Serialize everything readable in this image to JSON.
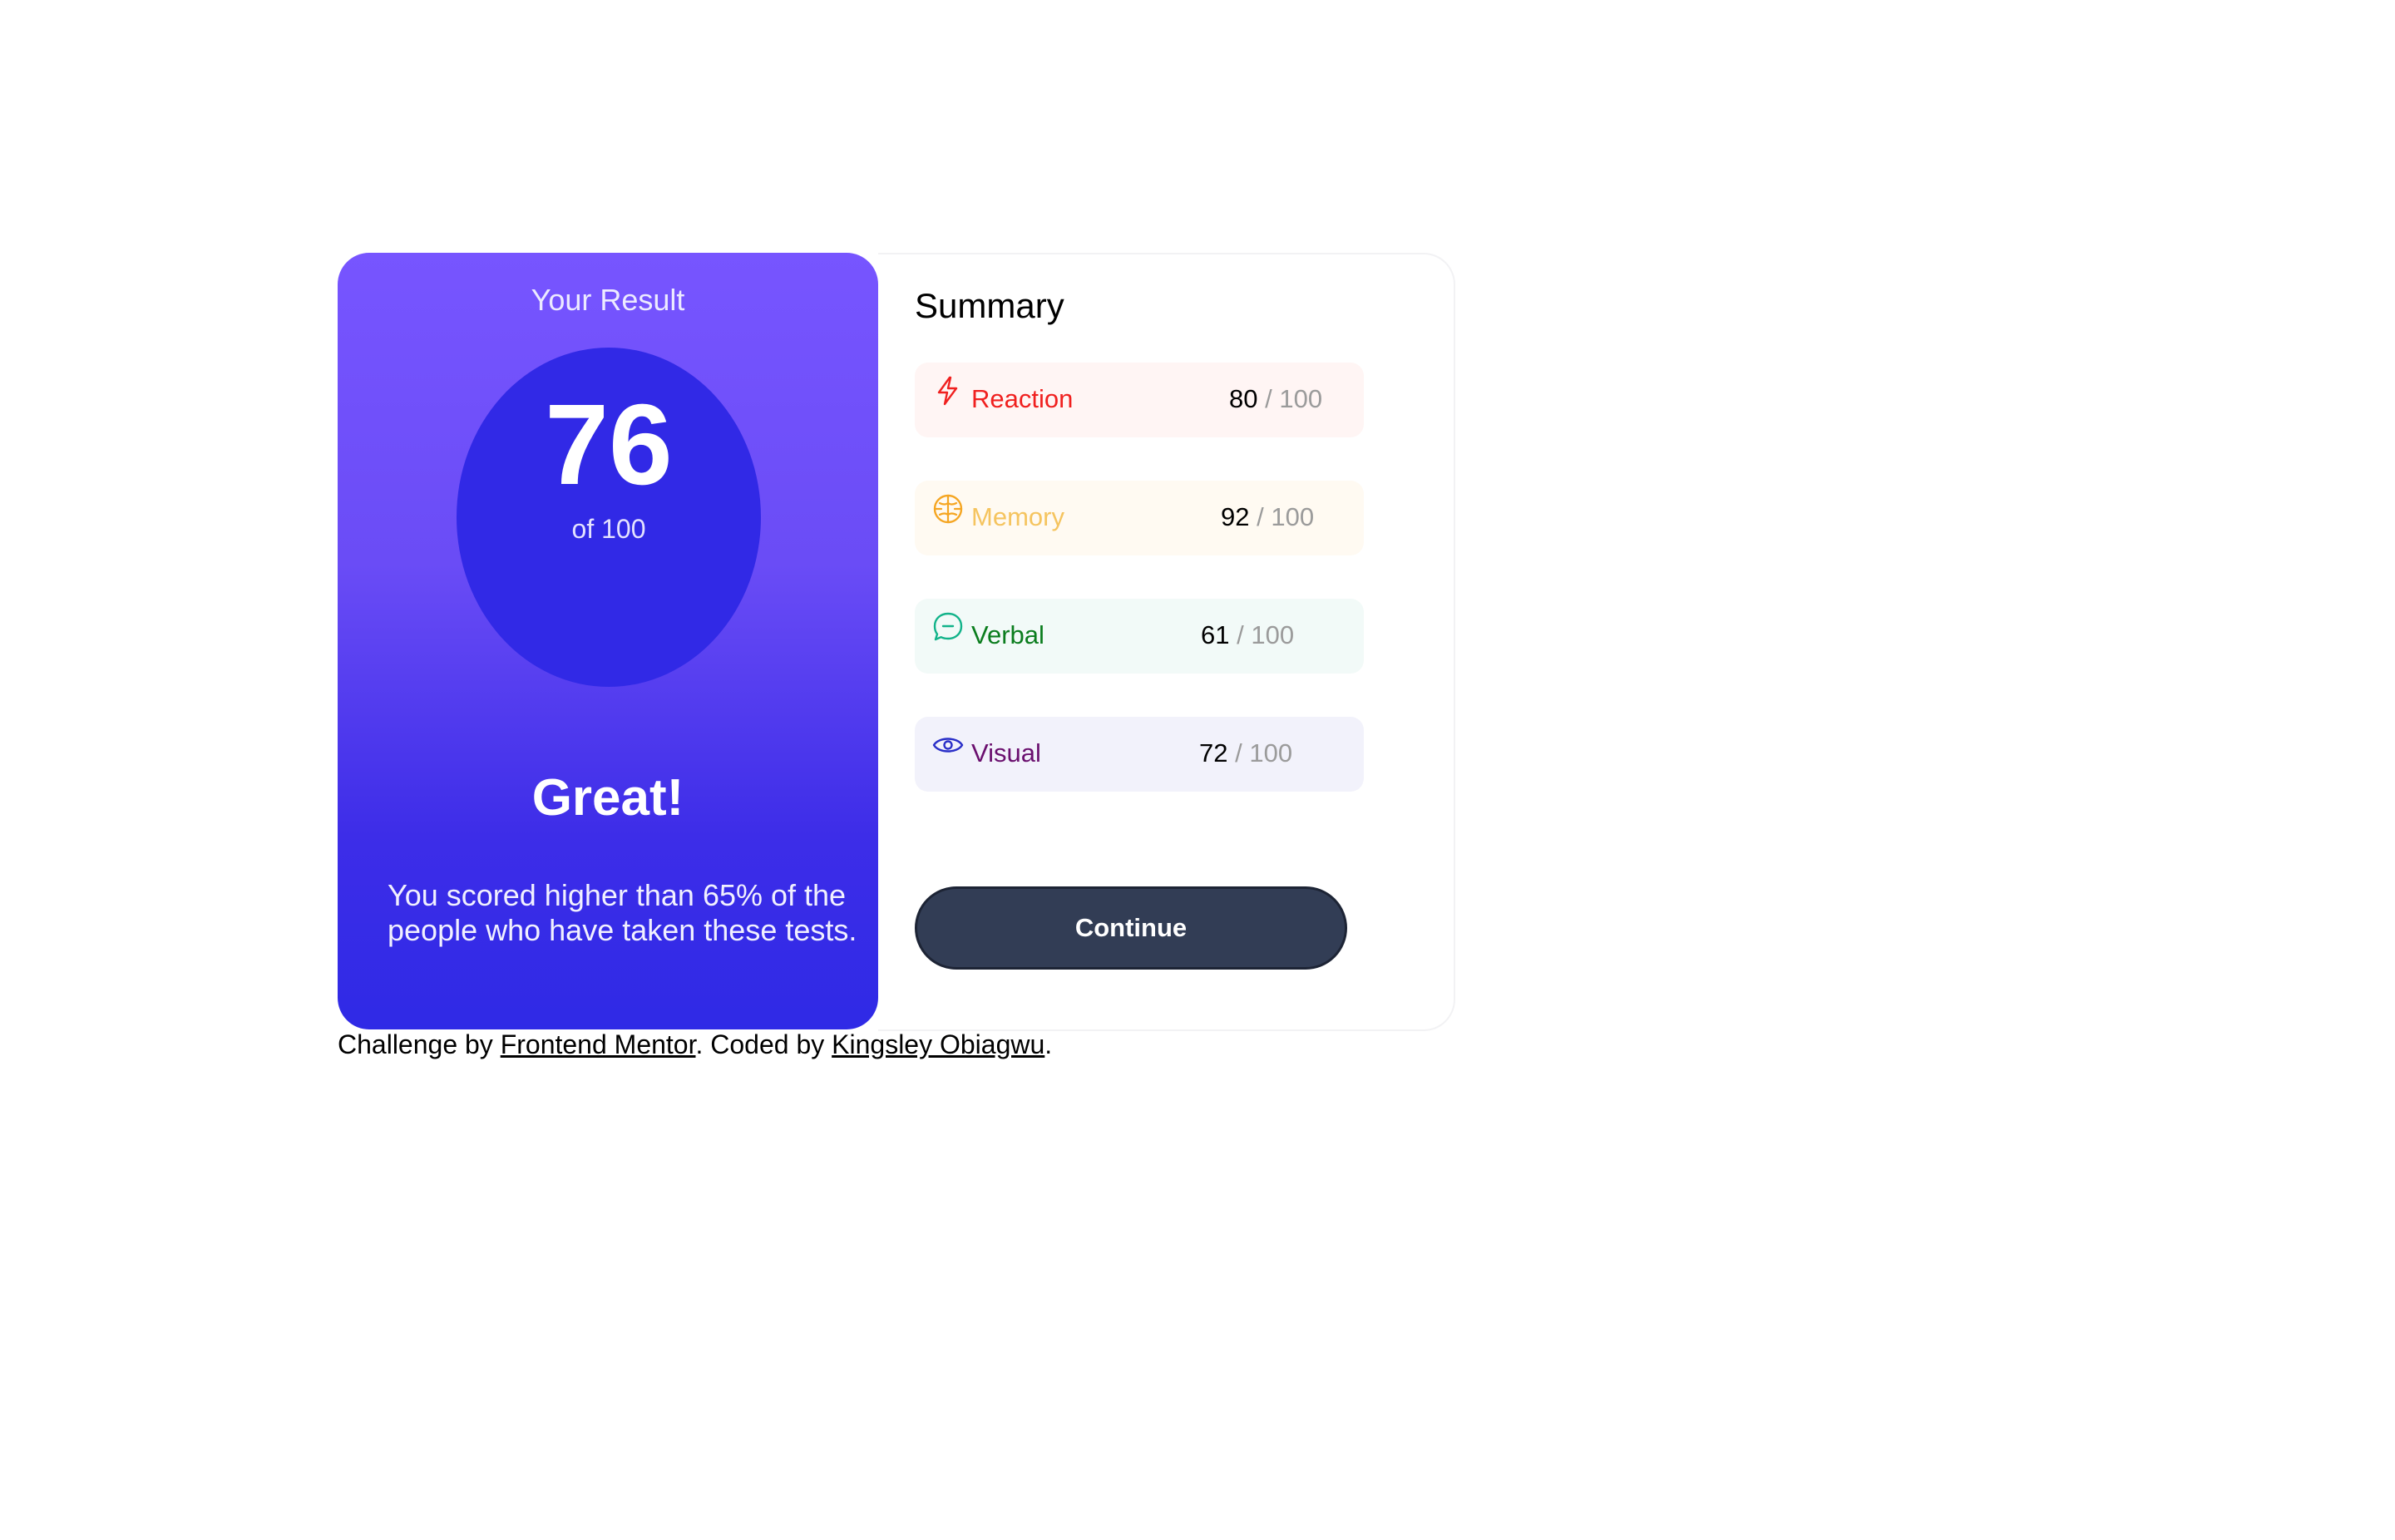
{
  "result": {
    "title": "Your Result",
    "score": "76",
    "of_label": "of 100",
    "grade": "Great!",
    "description": "You scored higher than 65% of the people who have taken these tests."
  },
  "summary": {
    "title": "Summary",
    "items": [
      {
        "label": "Reaction",
        "score": "80",
        "max": "/ 100",
        "icon": "lightning-icon",
        "color": "#f0201f",
        "bg": "#fff5f4"
      },
      {
        "label": "Memory",
        "score": "92",
        "max": "/ 100",
        "icon": "brain-icon",
        "color": "#f5c45f",
        "bg": "#fffaf2"
      },
      {
        "label": "Verbal",
        "score": "61",
        "max": "/ 100",
        "icon": "speech-bubble-icon",
        "color": "#0b7d1e",
        "bg": "#f2faf8"
      },
      {
        "label": "Visual",
        "score": "72",
        "max": "/ 100",
        "icon": "eye-icon",
        "color": "#6a0f6e",
        "bg": "#f2f2fb"
      }
    ],
    "continue_label": "Continue"
  },
  "footer": {
    "prefix": "Challenge by ",
    "link1": "Frontend Mentor",
    "middle": ". Coded by ",
    "link2": "Kingsley Obiagwu",
    "suffix": "."
  },
  "colors": {
    "gradient_top": "#7755ff",
    "gradient_bottom": "#2f2ae6",
    "circle": "#3129e6",
    "button": "#323d55"
  }
}
